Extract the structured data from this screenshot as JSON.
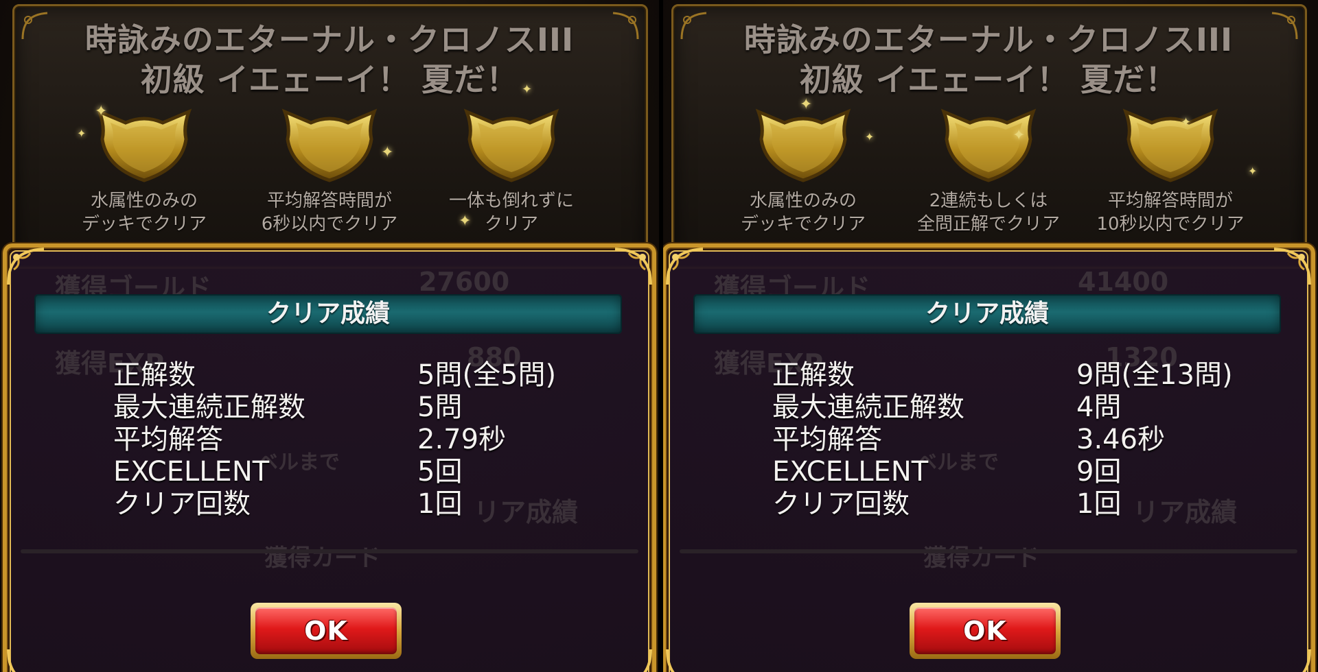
{
  "panels": [
    {
      "stage_title_line1": "時詠みのエターナル・クロノスIII",
      "stage_title_line2": "初級 イエェーイ！ 夏だ！",
      "conditions": [
        {
          "line1": "水属性のみの",
          "line2": "デッキでクリア"
        },
        {
          "line1": "平均解答時間が",
          "line2": "6秒以内でクリア"
        },
        {
          "line1": "一体も倒れずに",
          "line2": "クリア"
        }
      ],
      "background": {
        "gold_label": "獲得ゴールド",
        "gold_value": "27600",
        "exp_label": "獲得EXP",
        "exp_value": "880",
        "level_label": "ベルまで",
        "record_label": "リア成績",
        "cards_label": "獲得カード"
      },
      "dialog": {
        "title": "クリア成績",
        "rows": [
          {
            "label": "正解数",
            "value": "5問(全5問)"
          },
          {
            "label": "最大連続正解数",
            "value": "5問"
          },
          {
            "label": "平均解答",
            "value": "2.79秒"
          },
          {
            "label": "EXCELLENT",
            "value": "5回"
          },
          {
            "label": "クリア回数",
            "value": "1回"
          }
        ],
        "ok_label": "OK"
      }
    },
    {
      "stage_title_line1": "時詠みのエターナル・クロノスIII",
      "stage_title_line2": "初級 イエェーイ！ 夏だ！",
      "conditions": [
        {
          "line1": "水属性のみの",
          "line2": "デッキでクリア"
        },
        {
          "line1": "2連続もしくは",
          "line2": "全問正解でクリア"
        },
        {
          "line1": "平均解答時間が",
          "line2": "10秒以内でクリア"
        }
      ],
      "background": {
        "gold_label": "獲得ゴールド",
        "gold_value": "41400",
        "exp_label": "獲得EXP",
        "exp_value": "1320",
        "level_label": "ベルまで",
        "record_label": "リア成績",
        "cards_label": "獲得カード"
      },
      "dialog": {
        "title": "クリア成績",
        "rows": [
          {
            "label": "正解数",
            "value": "9問(全13問)"
          },
          {
            "label": "最大連続正解数",
            "value": "4問"
          },
          {
            "label": "平均解答",
            "value": "3.46秒"
          },
          {
            "label": "EXCELLENT",
            "value": "9回"
          },
          {
            "label": "クリア回数",
            "value": "1回"
          }
        ],
        "ok_label": "OK"
      }
    }
  ],
  "icons": {
    "emblem": "gold-shield-emblem-icon",
    "corner": "gold-filigree-corner-icon",
    "sparkle": "sparkle-icon"
  },
  "colors": {
    "gold_frame": "#c9952a",
    "banner_teal": "#1a6a70",
    "ok_red": "#e0191a",
    "dialog_bg": "#21132a"
  }
}
